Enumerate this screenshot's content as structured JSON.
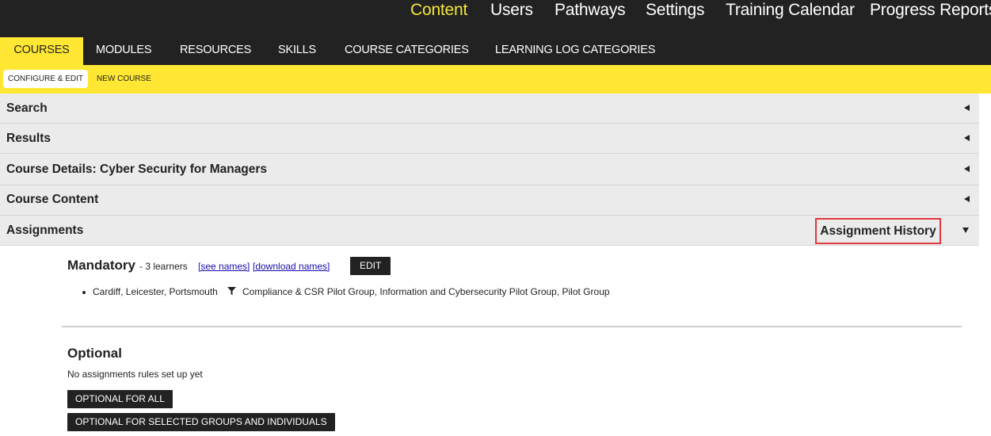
{
  "topnav": {
    "items": [
      {
        "label": "Content",
        "active": true
      },
      {
        "label": "Users"
      },
      {
        "label": "Pathways"
      },
      {
        "label": "Settings"
      },
      {
        "label": "Training Calendar"
      },
      {
        "label": "Progress Reports"
      }
    ]
  },
  "tabs": [
    {
      "label": "COURSES",
      "active": true
    },
    {
      "label": "MODULES"
    },
    {
      "label": "RESOURCES"
    },
    {
      "label": "SKILLS"
    },
    {
      "label": "COURSE CATEGORIES"
    },
    {
      "label": "LEARNING LOG CATEGORIES"
    }
  ],
  "subtabs": [
    {
      "label": "CONFIGURE & EDIT",
      "active": true
    },
    {
      "label": "NEW COURSE"
    }
  ],
  "sections": [
    {
      "label": "Search",
      "state": "collapsed"
    },
    {
      "label": "Results",
      "state": "collapsed"
    },
    {
      "label": "Course Details: Cyber Security for Managers",
      "state": "collapsed"
    },
    {
      "label": "Course Content",
      "state": "collapsed"
    },
    {
      "label": "Assignments",
      "state": "expanded"
    }
  ],
  "assignments": {
    "history_button": "Assignment History",
    "mandatory": {
      "title": "Mandatory",
      "count_text": "- 3 learners",
      "see_names": "[see names]",
      "download_names": "[download names]",
      "edit_button": "EDIT",
      "rule": {
        "locations": "Cardiff, Leicester, Portsmouth",
        "groups": "Compliance & CSR Pilot Group, Information and Cybersecurity Pilot Group, Pilot Group"
      }
    },
    "optional": {
      "title": "Optional",
      "empty_text": "No assignments rules set up yet",
      "btn_all": "OPTIONAL FOR ALL",
      "btn_selected": "OPTIONAL FOR SELECTED GROUPS AND INDIVIDUALS"
    }
  },
  "colors": {
    "accent": "#ffe733",
    "dark": "#222222",
    "highlight": "#e0393e",
    "link": "#1a0dab"
  }
}
